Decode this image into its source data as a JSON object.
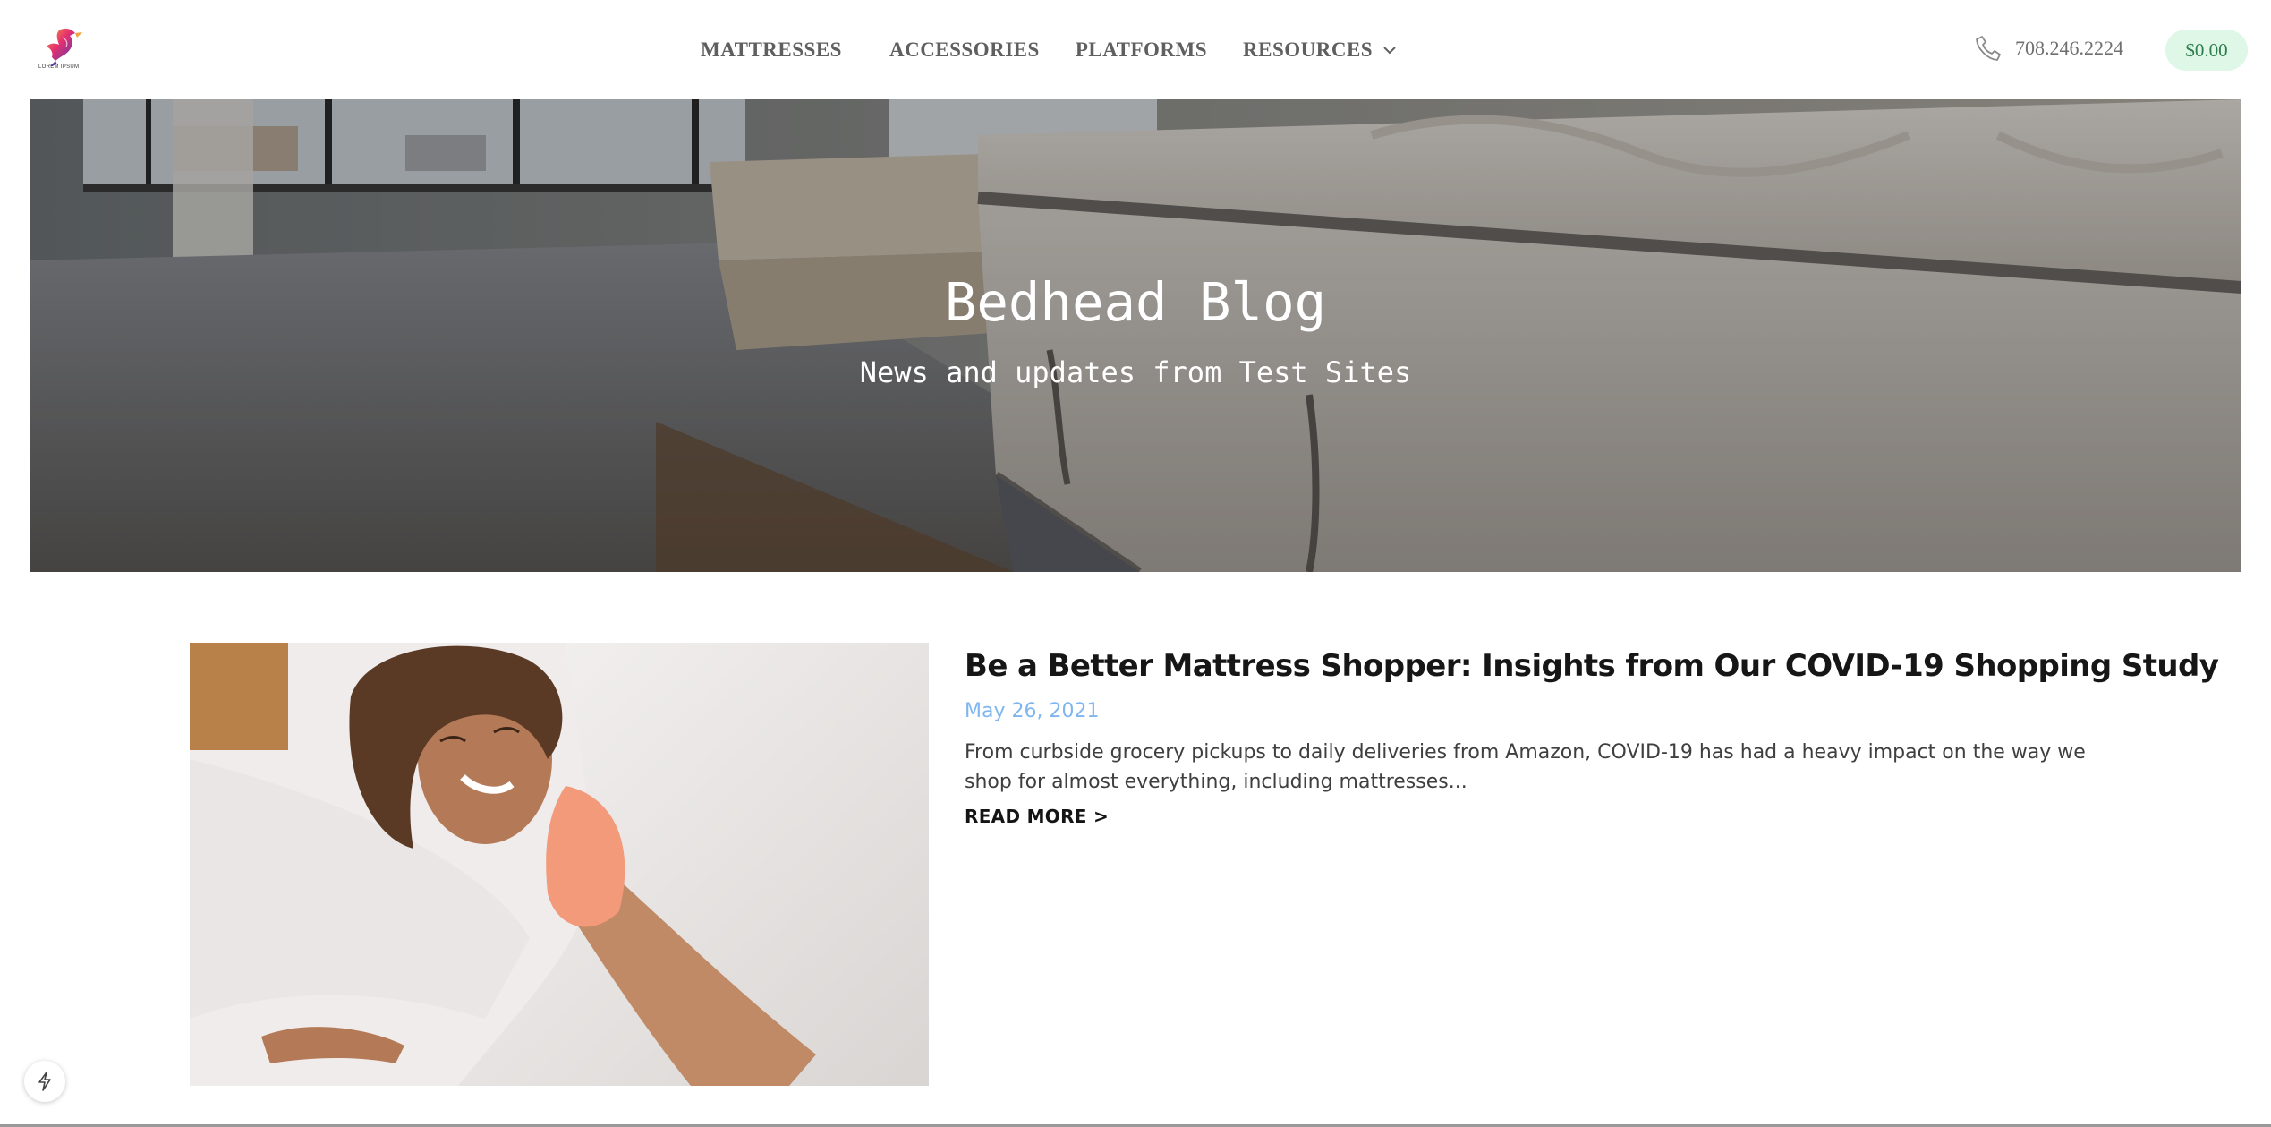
{
  "header": {
    "logo": {
      "brand_text": "LOREM IPSUM"
    },
    "nav": [
      {
        "label": "MATTRESSES"
      },
      {
        "label": "ACCESSORIES"
      },
      {
        "label": "PLATFORMS"
      },
      {
        "label": "RESOURCES"
      }
    ],
    "phone": "708.246.2224",
    "cart_total": "$0.00"
  },
  "hero": {
    "title": "Bedhead Blog",
    "subtitle": "News and updates from Test Sites"
  },
  "posts": [
    {
      "title": "Be a Better Mattress Shopper: Insights from Our COVID-19 Shopping Study",
      "date": "May 26, 2021",
      "excerpt": "From curbside grocery pickups to daily deliveries from Amazon, COVID-19 has had a heavy impact on the way we shop for almost everything, including mattresses...",
      "read_more": "READ MORE >"
    }
  ],
  "colors": {
    "nav_text": "#5f5f5f",
    "date_accent": "#7fb6ef",
    "cart_bg": "#def7e6",
    "cart_text": "#2f7d4d"
  },
  "icons": {
    "logo": "bird-logo-icon",
    "nav_dropdown": "chevron-down-icon",
    "phone": "phone-icon",
    "widget": "lightning-icon"
  }
}
